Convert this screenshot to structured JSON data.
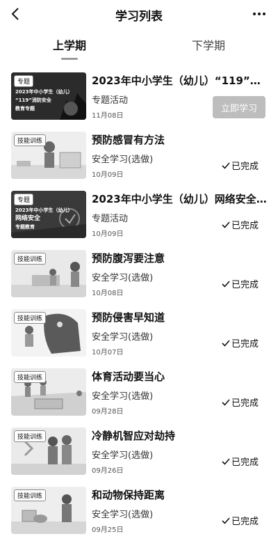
{
  "header": {
    "title": "学习列表",
    "back_icon": "chevron-left-icon",
    "more_icon": "more-dots-icon"
  },
  "tabs": [
    {
      "label": "上学期",
      "active": true
    },
    {
      "label": "下学期",
      "active": false
    }
  ],
  "items": [
    {
      "title": "2023年中小学生（幼儿）“119”消防安全教育专题",
      "category": "专题活动",
      "date": "11月08日",
      "action": "立即学习",
      "thumb": {
        "badge": "专题",
        "lines": [
          "2023年中小学生（幼儿）",
          "“119”消防安全",
          "教育专题"
        ]
      }
    },
    {
      "title": "预防感冒有方法",
      "category": "安全学习(选做)",
      "date": "10月09日",
      "status": "已完成",
      "thumb": {
        "badge": "技能训练"
      }
    },
    {
      "title": "2023年中小学生（幼儿）网络安全专题教育",
      "category": "专题活动",
      "date": "10月09日",
      "status": "已完成",
      "thumb": {
        "badge": "专题",
        "lines": [
          "2023年中小学生（幼儿）",
          "网络安全",
          "专题教育"
        ]
      }
    },
    {
      "title": "预防腹泻要注意",
      "category": "安全学习(选做)",
      "date": "10月08日",
      "status": "已完成",
      "thumb": {
        "badge": "技能训练"
      }
    },
    {
      "title": "预防侵害早知道",
      "category": "安全学习(选做)",
      "date": "10月07日",
      "status": "已完成",
      "thumb": {
        "badge": "技能训练"
      }
    },
    {
      "title": "体育活动要当心",
      "category": "安全学习(选做)",
      "date": "09月28日",
      "status": "已完成",
      "thumb": {
        "badge": "技能训练"
      }
    },
    {
      "title": "冷静机智应对劫持",
      "category": "安全学习(选做)",
      "date": "09月26日",
      "status": "已完成",
      "thumb": {
        "badge": "技能训练"
      }
    },
    {
      "title": "和动物保持距离",
      "category": "安全学习(选做)",
      "date": "09月25日",
      "status": "已完成",
      "thumb": {
        "badge": "技能训练"
      }
    }
  ]
}
